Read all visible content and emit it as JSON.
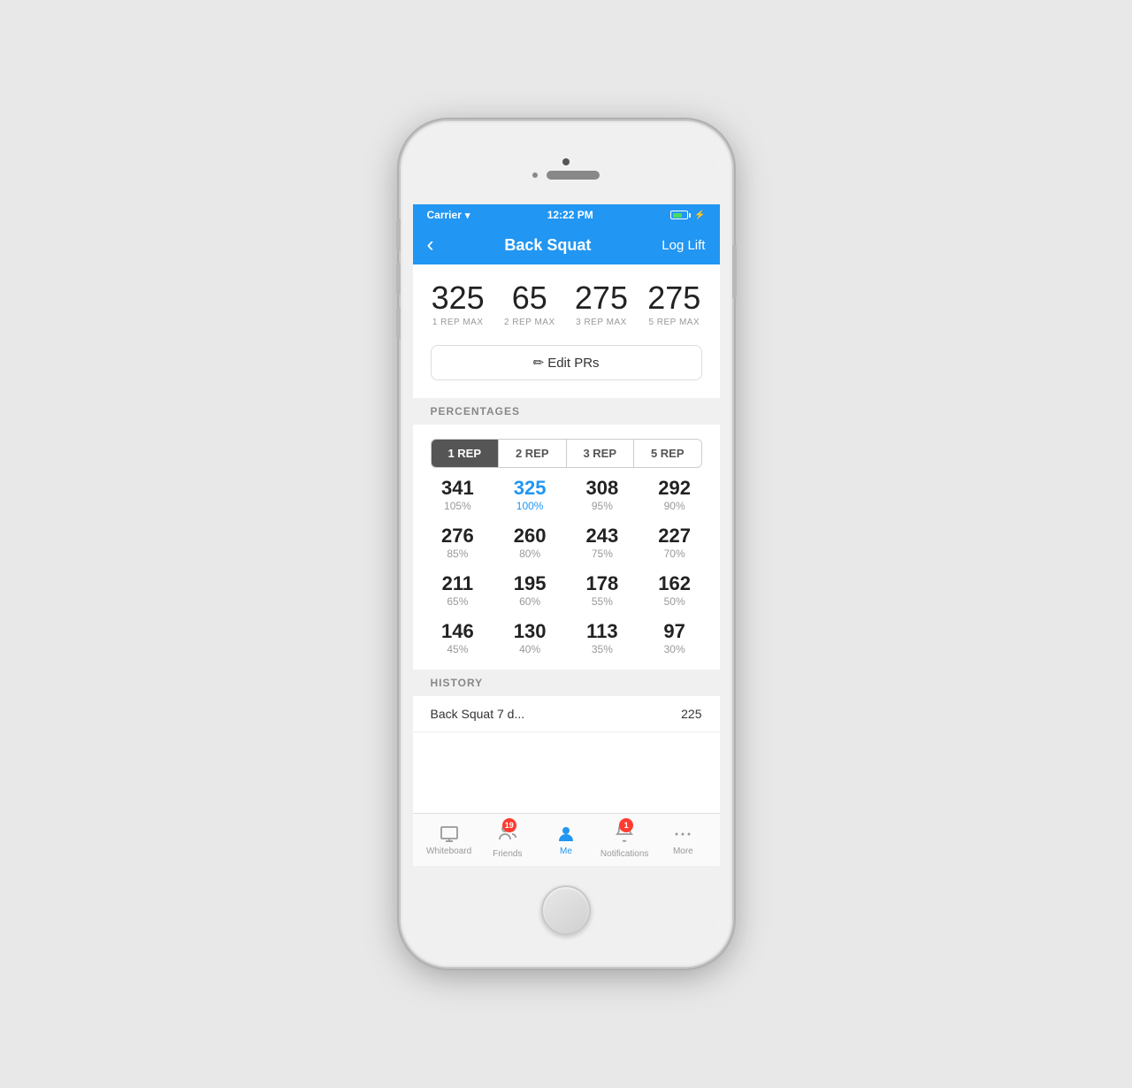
{
  "phone": {
    "statusBar": {
      "carrier": "Carrier",
      "time": "12:22 PM"
    },
    "navBar": {
      "backLabel": "‹",
      "title": "Back Squat",
      "actionLabel": "Log Lift"
    },
    "prStats": [
      {
        "value": "325",
        "label": "1 REP MAX"
      },
      {
        "value": "65",
        "label": "2 REP MAX"
      },
      {
        "value": "275",
        "label": "3 REP MAX"
      },
      {
        "value": "275",
        "label": "5 REP MAX"
      }
    ],
    "editPrsLabel": "✏ Edit PRs",
    "sections": {
      "percentages": "PERCENTAGES",
      "history": "HISTORY"
    },
    "repTabs": [
      {
        "label": "1 REP",
        "active": true
      },
      {
        "label": "2 REP",
        "active": false
      },
      {
        "label": "3 REP",
        "active": false
      },
      {
        "label": "5 REP",
        "active": false
      }
    ],
    "pctGrid": [
      [
        {
          "value": "341",
          "pct": "105%",
          "highlight": false
        },
        {
          "value": "325",
          "pct": "100%",
          "highlight": true
        },
        {
          "value": "308",
          "pct": "95%",
          "highlight": false
        },
        {
          "value": "292",
          "pct": "90%",
          "highlight": false
        }
      ],
      [
        {
          "value": "276",
          "pct": "85%",
          "highlight": false
        },
        {
          "value": "260",
          "pct": "80%",
          "highlight": false
        },
        {
          "value": "243",
          "pct": "75%",
          "highlight": false
        },
        {
          "value": "227",
          "pct": "70%",
          "highlight": false
        }
      ],
      [
        {
          "value": "211",
          "pct": "65%",
          "highlight": false
        },
        {
          "value": "195",
          "pct": "60%",
          "highlight": false
        },
        {
          "value": "178",
          "pct": "55%",
          "highlight": false
        },
        {
          "value": "162",
          "pct": "50%",
          "highlight": false
        }
      ],
      [
        {
          "value": "146",
          "pct": "45%",
          "highlight": false
        },
        {
          "value": "130",
          "pct": "40%",
          "highlight": false
        },
        {
          "value": "113",
          "pct": "35%",
          "highlight": false
        },
        {
          "value": "97",
          "pct": "30%",
          "highlight": false
        }
      ]
    ],
    "historyPreview": {
      "leftText": "Back Squat 7 d...",
      "rightText": "225"
    },
    "tabBar": [
      {
        "id": "whiteboard",
        "label": "Whiteboard",
        "active": false,
        "badge": null
      },
      {
        "id": "friends",
        "label": "Friends",
        "active": false,
        "badge": "19"
      },
      {
        "id": "me",
        "label": "Me",
        "active": true,
        "badge": null
      },
      {
        "id": "notifications",
        "label": "Notifications",
        "active": false,
        "badge": "1"
      },
      {
        "id": "more",
        "label": "More",
        "active": false,
        "badge": null
      }
    ]
  }
}
